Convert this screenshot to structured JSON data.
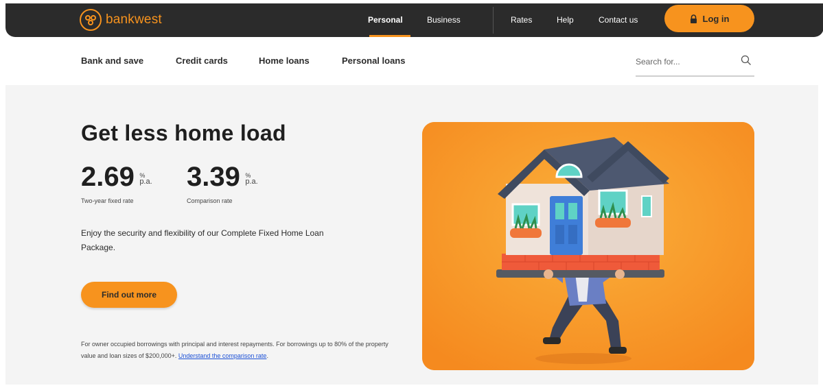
{
  "header": {
    "brand": "bankwest",
    "nav": [
      {
        "label": "Personal",
        "active": true
      },
      {
        "label": "Business",
        "active": false
      },
      {
        "label": "Rates",
        "active": false
      },
      {
        "label": "Help",
        "active": false
      },
      {
        "label": "Contact us",
        "active": false
      }
    ],
    "login_label": "Log in",
    "accent_color": "#f7931e"
  },
  "subnav": {
    "items": [
      {
        "label": "Bank and save"
      },
      {
        "label": "Credit cards"
      },
      {
        "label": "Home loans"
      },
      {
        "label": "Personal loans"
      }
    ],
    "search_placeholder": "Search for..."
  },
  "hero": {
    "headline": "Get less home load",
    "rates": [
      {
        "value": "2.69",
        "percent": "%",
        "unit": "p.a.",
        "label": "Two-year fixed rate"
      },
      {
        "value": "3.39",
        "percent": "%",
        "unit": "p.a.",
        "label": "Comparison rate"
      }
    ],
    "description": "Enjoy the security and flexibility of our Complete Fixed Home Loan Package.",
    "cta_label": "Find out more",
    "footnote_text": "For owner occupied borrowings with principal and interest repayments. For borrowings up to 80% of the property value and loan sizes of $200,000+. ",
    "footnote_link": "Understand the comparison rate",
    "footnote_end": "."
  }
}
